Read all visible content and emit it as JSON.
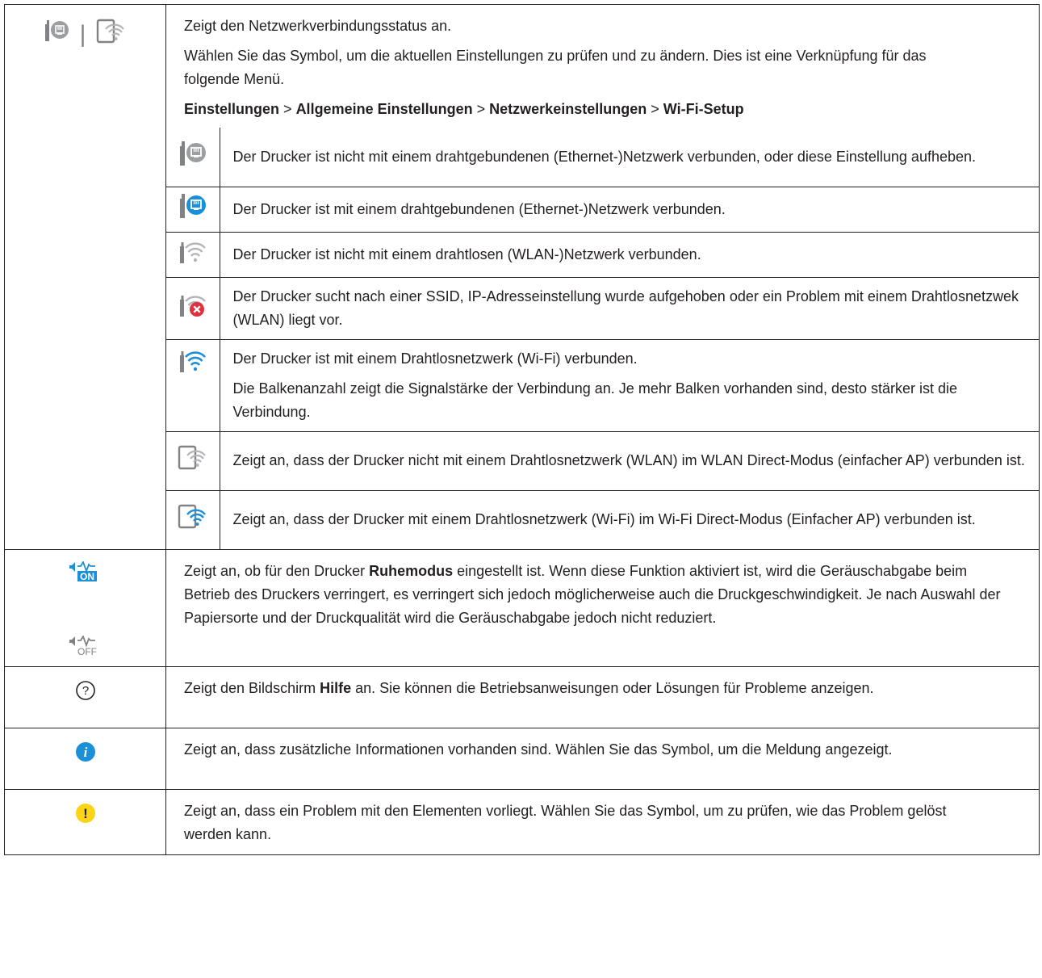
{
  "network": {
    "p1": "Zeigt den Netzwerkverbindungsstatus an.",
    "p2": "Wählen Sie das Symbol, um die aktuellen Einstellungen zu prüfen und zu ändern. Dies ist eine Verknüpfung für das folgende Menü.",
    "path": [
      "Einstellungen",
      "Allgemeine Einstellungen",
      "Netzwerkeinstellungen",
      "Wi-Fi-Setup"
    ],
    "separator": ">",
    "icon_sep": "|",
    "status": [
      {
        "icon": "ethernet-disconnected-icon",
        "text": "Der Drucker ist nicht mit einem drahtgebundenen (Ethernet-)Netzwerk verbunden, oder diese Einstellung aufheben."
      },
      {
        "icon": "ethernet-connected-icon",
        "text": "Der Drucker ist mit einem drahtgebundenen (Ethernet-)Netzwerk verbunden."
      },
      {
        "icon": "wlan-disconnected-icon",
        "text": "Der Drucker ist nicht mit einem drahtlosen (WLAN-)Netzwerk verbunden."
      },
      {
        "icon": "wlan-error-icon",
        "text": "Der Drucker sucht nach einer SSID, IP-Adresseinstellung wurde aufgehoben oder ein Problem mit einem Drahtlosnetzwek (WLAN) liegt vor."
      },
      {
        "icon": "wlan-connected-icon",
        "text": "Der Drucker ist mit einem Drahtlosnetzwerk (Wi-Fi) verbunden.",
        "text2": "Die Balkenanzahl zeigt die Signalstärke der Verbindung an. Je mehr Balken vorhanden sind, desto stärker ist die Verbindung."
      },
      {
        "icon": "wifi-direct-disconnected-icon",
        "text": "Zeigt an, dass der Drucker nicht mit einem Drahtlosnetzwerk (WLAN) im WLAN Direct-Modus (einfacher AP) verbunden ist."
      },
      {
        "icon": "wifi-direct-connected-icon",
        "text": "Zeigt an, dass der Drucker mit einem Drahtlosnetzwerk (Wi-Fi) im Wi-Fi Direct-Modus (Einfacher AP) verbunden ist."
      }
    ]
  },
  "quiet": {
    "pre": "Zeigt an, ob für den Drucker ",
    "bold": "Ruhemodus",
    "post": " eingestellt ist. Wenn diese Funktion aktiviert ist, wird die Geräuschabgabe beim Betrieb des Druckers verringert, es verringert sich jedoch möglicherweise auch die Druckgeschwindigkeit. Je nach Auswahl der Papiersorte und der Druckqualität wird die Geräuschabgabe jedoch nicht reduziert.",
    "on_label": "ON",
    "off_label": "OFF"
  },
  "help": {
    "pre": "Zeigt den Bildschirm ",
    "bold": "Hilfe",
    "post": " an. Sie können die Betriebsanweisungen oder Lösungen für Probleme anzeigen.",
    "icon_glyph": "?"
  },
  "info": {
    "text": "Zeigt an, dass zusätzliche Informationen vorhanden sind. Wählen Sie das Symbol, um die Meldung angezeigt.",
    "icon_glyph": "i"
  },
  "warning": {
    "text": "Zeigt an, dass ein Problem mit den Elementen vorliegt. Wählen Sie das Symbol, um zu prüfen, wie das Problem gelöst werden kann.",
    "icon_glyph": "!"
  },
  "colors": {
    "text": "#231f20",
    "icon_gray": "#808285",
    "accent_blue": "#1b8fd8",
    "error_red": "#e0323e",
    "warning_yellow": "#fcd416"
  }
}
